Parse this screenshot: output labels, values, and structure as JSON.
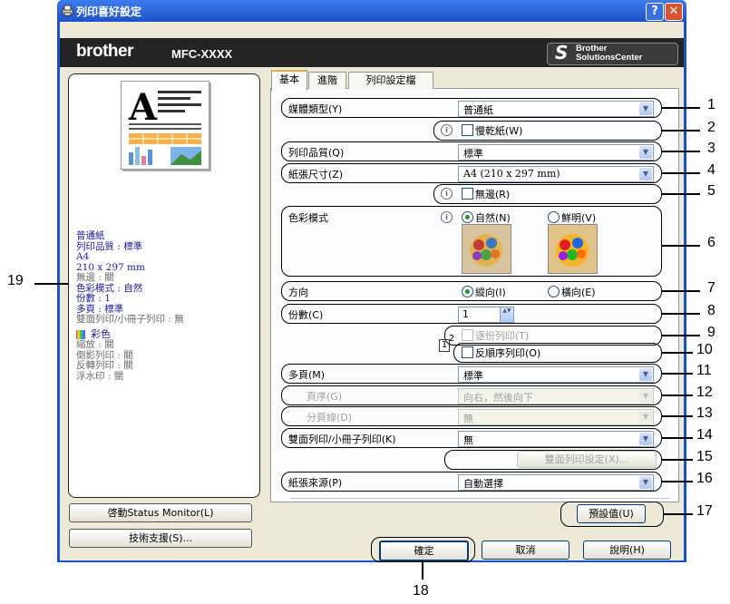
{
  "window": {
    "title": "列印喜好設定",
    "help_glyph": "?",
    "close_glyph": "✕"
  },
  "banner": {
    "brand": "brother",
    "model": "MFC-XXXX",
    "solutions_line1": "Brother",
    "solutions_line2": "SolutionsCenter"
  },
  "summary": {
    "lines": [
      "普通紙",
      "列印品質 : 標準",
      "A4",
      "210 x 297 mm"
    ],
    "gray1": [
      "無邊 : 關"
    ],
    "lines2": [
      "色彩模式 : 自然",
      "份數 : 1",
      "多頁 : 標準"
    ],
    "gray2": [
      "雙面列印/小冊子列印 : 無"
    ],
    "color_label": "彩色",
    "gray3": [
      "縮放 : 關",
      "倒影列印 : 關",
      "反轉列印 : 關",
      "浮水印 : 關"
    ]
  },
  "left_buttons": {
    "status_monitor": "啓動Status Monitor(L)",
    "support": "技術支援(S)..."
  },
  "tabs": [
    {
      "label": "基本"
    },
    {
      "label": "進階"
    },
    {
      "label": "列印設定檔"
    }
  ],
  "settings": {
    "media_type": {
      "label": "媒體類型(Y)",
      "value": "普通紙"
    },
    "slow_dry": {
      "label": "慢乾紙(W)"
    },
    "print_quality": {
      "label": "列印品質(Q)",
      "value": "標準"
    },
    "paper_size": {
      "label": "紙張尺寸(Z)",
      "value": "A4 (210 x 297 mm)"
    },
    "borderless": {
      "label": "無邊(R)"
    },
    "color_mode": {
      "label": "色彩模式",
      "natural": "自然(N)",
      "vivid": "鮮明(V)"
    },
    "orientation": {
      "label": "方向",
      "portrait": "縱向(I)",
      "landscape": "橫向(E)"
    },
    "copies": {
      "label": "份數(C)",
      "value": "1"
    },
    "collate": {
      "label": "逐份列印(T)"
    },
    "reverse_order": {
      "label": "反順序列印(O)"
    },
    "multiple_page": {
      "label": "多頁(M)",
      "value": "標準"
    },
    "page_order": {
      "label": "頁序(G)",
      "value": "向右，然後向下"
    },
    "border_line": {
      "label": "分頁線(D)",
      "value": "無"
    },
    "duplex": {
      "label": "雙面列印/小冊子列印(K)",
      "value": "無"
    },
    "duplex_settings_button": "雙面列印設定(X)...",
    "paper_source": {
      "label": "紙張來源(P)",
      "value": "自動選擇"
    },
    "default_button": "預設值(U)"
  },
  "bottom_buttons": {
    "ok": "確定",
    "cancel": "取消",
    "help": "說明(H)"
  },
  "callouts": [
    "1",
    "2",
    "3",
    "4",
    "5",
    "6",
    "7",
    "8",
    "9",
    "10",
    "11",
    "12",
    "13",
    "14",
    "15",
    "16",
    "17",
    "18",
    "19"
  ],
  "info_glyph": "i",
  "dropdown_glyph": "▼",
  "spinner_glyph": "▲▼",
  "collate_glyph_1": "1",
  "collate_glyph_2": "2",
  "colors": {
    "title_bar": "#1c52c9",
    "banner": "#242424",
    "dialog_bg": "#ece9d8",
    "tab_accent": "#f3a83b"
  }
}
